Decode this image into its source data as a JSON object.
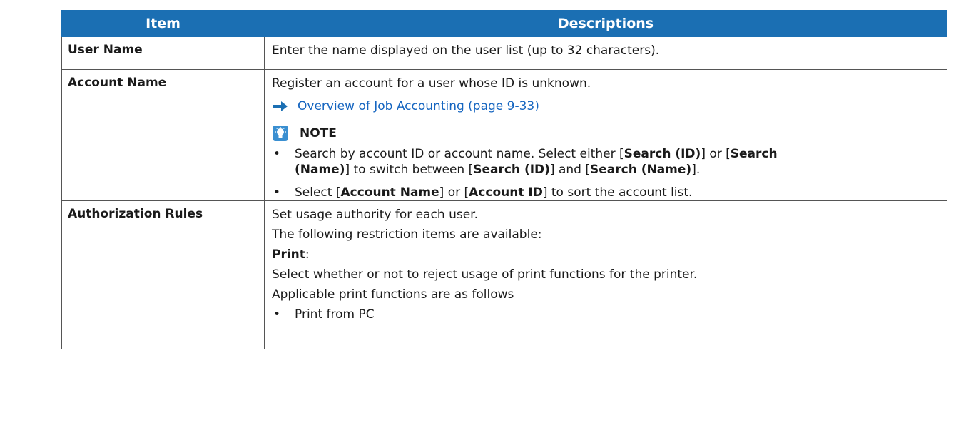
{
  "table": {
    "headers": {
      "item": "Item",
      "descriptions": "Descriptions"
    },
    "rows": [
      {
        "item": "User Name",
        "desc": "Enter the name displayed on the user list (up to 32 characters)."
      },
      {
        "item": "Account Name",
        "desc": "Register an account for a user whose ID is unknown.",
        "link": "Overview of Job Accounting (page 9-33)",
        "note_title": "NOTE",
        "note1": {
          "dot": "•",
          "p1": "Search by account ID or account name. Select either [",
          "b1": "Search (ID)",
          "p2": "] or [",
          "b2": "Search",
          "b3": "(Name)",
          "p3": "] to switch between [",
          "b4": "Search (ID)",
          "p4": "] and [",
          "b5": "Search (Name)",
          "p5": "]."
        },
        "note2": {
          "dot": "•",
          "p1": "Select [",
          "b1": "Account Name",
          "p2": "] or [",
          "b2": "Account ID",
          "p3": "] to sort the account list."
        }
      },
      {
        "item": "Authorization Rules",
        "l1": "Set usage authority for each user.",
        "l2": "The following restriction items are available:",
        "l3_bold": "Print",
        "l3_colon": ":",
        "l4": "Select whether or not to reject usage of print functions for the printer.",
        "l5": "Applicable print functions are as follows",
        "bullet_dot": "•",
        "bullet": "Print from PC"
      }
    ]
  },
  "colors": {
    "header_bg": "#1b6fb3",
    "link": "#1565c0",
    "arrow": "#1b6fb3"
  }
}
